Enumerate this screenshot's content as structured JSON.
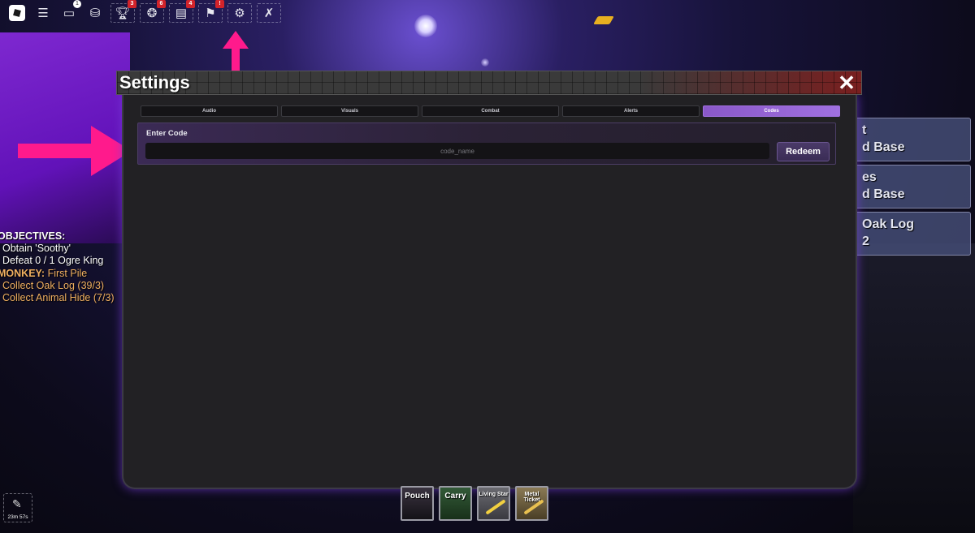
{
  "topbar": {
    "items": [
      {
        "icon": "roblox-logo"
      },
      {
        "icon": "menu-icon"
      },
      {
        "icon": "chat-icon",
        "badge": "1"
      },
      {
        "icon": "backpack-icon"
      },
      {
        "icon": "trophy-icon",
        "badge": "3"
      },
      {
        "icon": "pets-icon",
        "badge": "6"
      },
      {
        "icon": "book-icon",
        "badge": "4"
      },
      {
        "icon": "quest-icon",
        "badge": "!"
      },
      {
        "icon": "gear-icon"
      },
      {
        "icon": "map-icon"
      }
    ]
  },
  "objectives": {
    "header": "OBJECTIVES:",
    "lines": [
      "Obtain 'Soothy'",
      "Defeat 0 / 1 Ogre King"
    ],
    "monkey_label": "MONKEY:",
    "monkey_task": "First Pile",
    "monkey_lines": [
      "Collect Oak Log (39/3)",
      "Collect Animal Hide (7/3)"
    ]
  },
  "side_panels": [
    {
      "line1": "t",
      "line2": "d Base"
    },
    {
      "line1": "es",
      "line2": "d Base"
    },
    {
      "line1": "Oak Log",
      "line2": "2"
    }
  ],
  "settings": {
    "title": "Settings",
    "close": "✕",
    "tabs": [
      "Audio",
      "Visuals",
      "Combat",
      "Alerts",
      "Codes"
    ],
    "active_tab": "Codes",
    "code_section": {
      "label": "Enter Code",
      "placeholder": "code_name",
      "value": "",
      "button": "Redeem"
    }
  },
  "hotbar": [
    {
      "label": "Pouch"
    },
    {
      "label": "Carry"
    },
    {
      "label": "Living Star"
    },
    {
      "label": "Metal Ticket"
    }
  ],
  "timer": {
    "text": "23m 57s"
  },
  "colors": {
    "accent_purple": "#a070e0",
    "annotation_pink": "#ff1a8c",
    "objective_orange": "#f0b060"
  }
}
